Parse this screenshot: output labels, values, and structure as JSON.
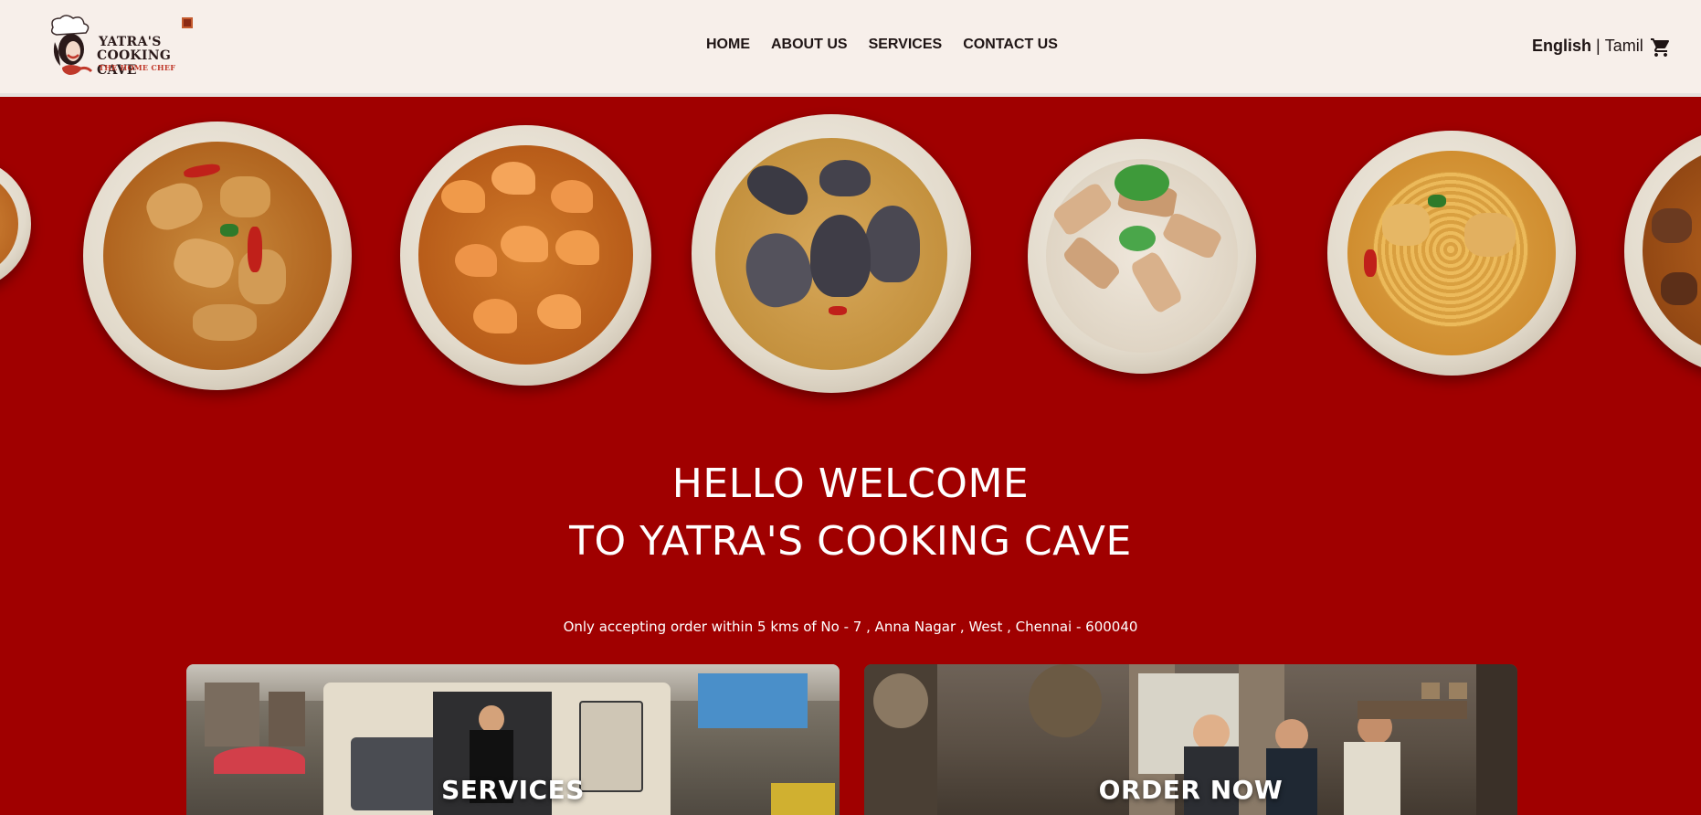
{
  "brand": {
    "name_line1": "YATRA'S",
    "name_line2": "COOKING CAVE",
    "tagline": "THE HOME CHEF",
    "accent": "#a00000"
  },
  "nav": {
    "items": [
      "HOME",
      "ABOUT US",
      "SERVICES",
      "CONTACT US"
    ]
  },
  "language": {
    "english": "English",
    "separator": "|",
    "tamil": "Tamil"
  },
  "cart": {
    "icon": "cart-icon"
  },
  "hero": {
    "dishes": [
      "chicken-curry",
      "prawn-curry",
      "clam-curry",
      "grilled-chicken-rice",
      "chicken-noodle-curry"
    ]
  },
  "welcome": {
    "line1": "HELLO WELCOME",
    "line2": "TO YATRA'S COOKING CAVE"
  },
  "notice": "Only accepting order within 5 kms of No - 7 , Anna Nagar , West , Chennai - 600040",
  "cards": {
    "services": "SERVICES",
    "order_now": "ORDER NOW"
  }
}
